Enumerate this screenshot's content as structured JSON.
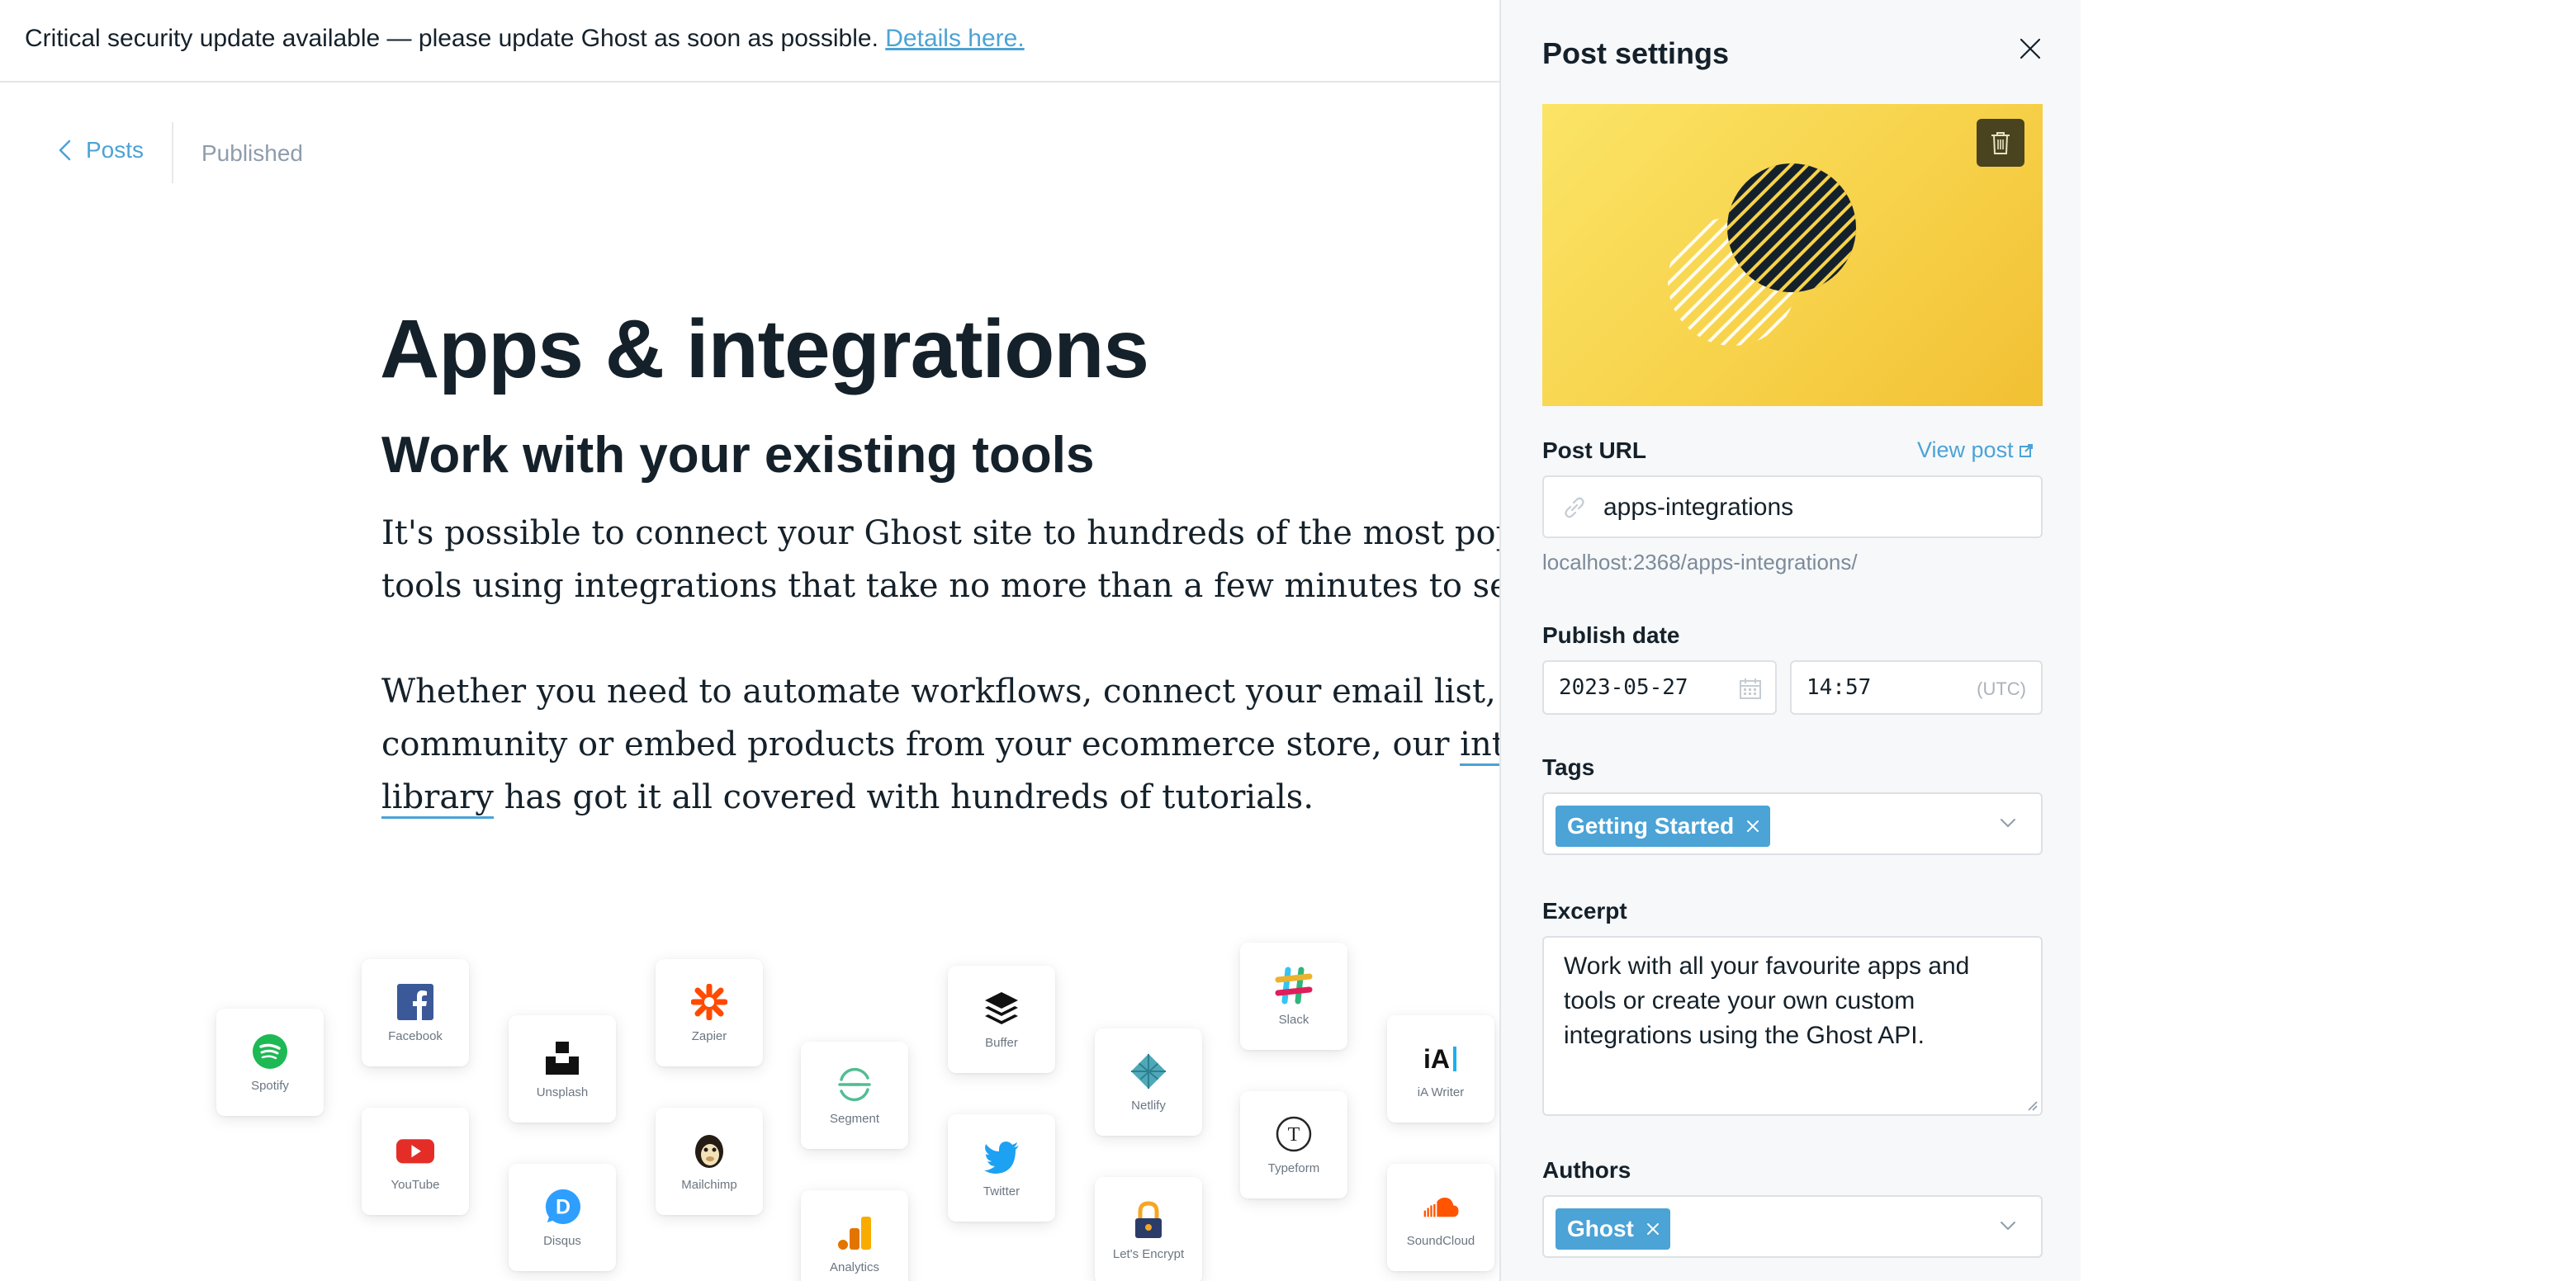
{
  "banner": {
    "text": "Critical security update available — please update Ghost as soon as possible.",
    "link": "Details here."
  },
  "nav": {
    "back_label": "Posts",
    "status": "Published"
  },
  "post": {
    "title": "Apps & integrations",
    "subtitle": "Work with your existing tools",
    "p1_line1": "It's possible to connect your Ghost site to hundreds of the most popular apps and",
    "p1_line2": "tools using integrations that take no more than a few minutes to setup.",
    "p2_line1": "Whether you need to automate workflows, connect your email list, build a",
    "p2_line2_pre": "community or embed products from your ecommerce store, our ",
    "p2_line2_link": "integrations",
    "p2_line3_link": "library",
    "p2_line3_post": " has got it all covered with hundreds of tutorials."
  },
  "apps": [
    {
      "name": "Spotify",
      "icon": "spotify-icon",
      "color": "#1db954"
    },
    {
      "name": "Facebook",
      "icon": "facebook-icon",
      "color": "#3b5998"
    },
    {
      "name": "YouTube",
      "icon": "youtube-icon",
      "color": "#e52d27"
    },
    {
      "name": "Unsplash",
      "icon": "unsplash-icon",
      "color": "#111111"
    },
    {
      "name": "Disqus",
      "icon": "disqus-icon",
      "color": "#2e9fff"
    },
    {
      "name": "Zapier",
      "icon": "zapier-icon",
      "color": "#ff4a00"
    },
    {
      "name": "Mailchimp",
      "icon": "mailchimp-icon",
      "color": "#241c15"
    },
    {
      "name": "Segment",
      "icon": "segment-icon",
      "color": "#52bd94"
    },
    {
      "name": "Analytics",
      "icon": "analytics-icon",
      "color": "#f9ab00"
    },
    {
      "name": "Buffer",
      "icon": "buffer-icon",
      "color": "#111111"
    },
    {
      "name": "Twitter",
      "icon": "twitter-icon",
      "color": "#1da1f2"
    },
    {
      "name": "Netlify",
      "icon": "netlify-icon",
      "color": "#4fa8b8"
    },
    {
      "name": "Let's Encrypt",
      "icon": "letsencrypt-icon",
      "color": "#f5a623"
    },
    {
      "name": "Slack",
      "icon": "slack-icon",
      "color": "#e01e5a"
    },
    {
      "name": "Typeform",
      "icon": "typeform-icon",
      "color": "#262627"
    },
    {
      "name": "iA Writer",
      "icon": "iawriter-icon",
      "color": "#111111"
    },
    {
      "name": "SoundCloud",
      "icon": "soundcloud-icon",
      "color": "#ff5500"
    }
  ],
  "panel": {
    "title": "Post settings",
    "post_url_label": "Post URL",
    "view_post": "View post",
    "slug": "apps-integrations",
    "url_hint": "localhost:2368/apps-integrations/",
    "publish_date_label": "Publish date",
    "date": "2023-05-27",
    "time": "14:57",
    "timezone": "(UTC)",
    "tags_label": "Tags",
    "tags": [
      "Getting Started"
    ],
    "excerpt_label": "Excerpt",
    "excerpt": "Work with all your favourite apps and tools or create your own custom integrations using the Ghost API.",
    "authors_label": "Authors",
    "authors": [
      "Ghost"
    ]
  },
  "colors": {
    "accent": "#4ba3d6",
    "chip": "#4ba3d6",
    "feature_image": "#f7d24a"
  }
}
